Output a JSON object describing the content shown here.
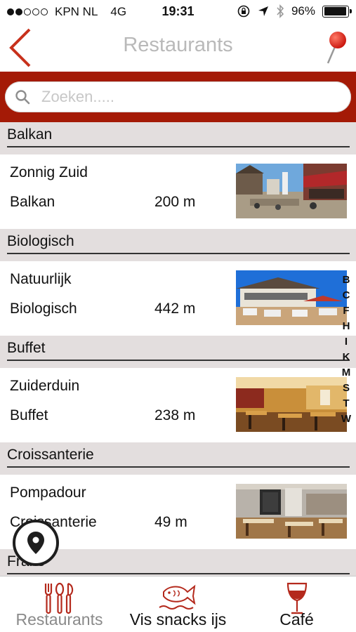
{
  "status_bar": {
    "carrier": "KPN NL",
    "network": "4G",
    "time": "19:31",
    "battery": "96%",
    "battery_level": 0.96,
    "signal_bars": 2
  },
  "nav": {
    "title": "Restaurants",
    "accent": "#c8311c",
    "search_bg": "#a41a06"
  },
  "search": {
    "placeholder": "Zoeken....."
  },
  "sections": [
    {
      "header": "Balkan",
      "items": [
        {
          "name": "Zonnig Zuid",
          "category": "Balkan",
          "distance": "200 m",
          "image": "street-terrace"
        }
      ]
    },
    {
      "header": "Biologisch",
      "items": [
        {
          "name": "Natuurlijk",
          "category": "Biologisch",
          "distance": "442 m",
          "image": "beach-pavilion"
        }
      ]
    },
    {
      "header": "Buffet",
      "items": [
        {
          "name": "Zuiderduin",
          "category": "Buffet",
          "distance": "238 m",
          "image": "buffet-hall"
        }
      ]
    },
    {
      "header": "Croissanterie",
      "items": [
        {
          "name": "Pompadour",
          "category": "Croissanterie",
          "distance": "49 m",
          "image": "cafe-interior"
        }
      ]
    },
    {
      "header": "Frans",
      "items": []
    }
  ],
  "alphabet_index": [
    "B",
    "C",
    "F",
    "H",
    "I",
    "K",
    "M",
    "S",
    "T",
    "W"
  ],
  "tabs": [
    {
      "label": "Restaurants",
      "icon": "cutlery-icon",
      "active": true
    },
    {
      "label": "Vis snacks ijs",
      "icon": "fish-icon",
      "active": false
    },
    {
      "label": "Café",
      "icon": "wine-glass-icon",
      "active": false
    }
  ]
}
